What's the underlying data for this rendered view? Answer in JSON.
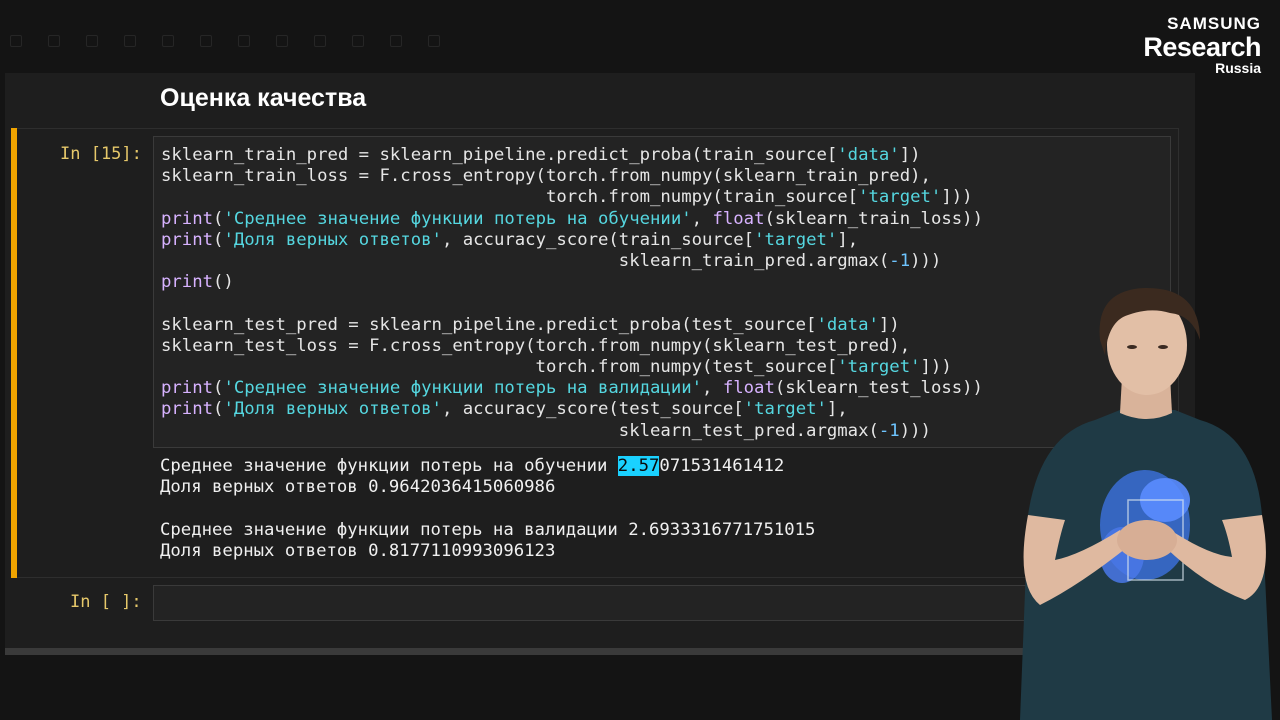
{
  "logo": {
    "line1": "SAMSUNG",
    "line2": "Research",
    "line3": "Russia"
  },
  "notebook": {
    "section_title": "Оценка качества",
    "cells": [
      {
        "prompt": "In [15]:",
        "code_lines": [
          "sklearn_train_pred = sklearn_pipeline.predict_proba(train_source['data'])",
          "sklearn_train_loss = F.cross_entropy(torch.from_numpy(sklearn_train_pred),",
          "                                     torch.from_numpy(train_source['target']))",
          "print('Среднее значение функции потерь на обучении', float(sklearn_train_loss))",
          "print('Доля верных ответов', accuracy_score(train_source['target'],",
          "                                            sklearn_train_pred.argmax(-1)))",
          "print()",
          "",
          "sklearn_test_pred = sklearn_pipeline.predict_proba(test_source['data'])",
          "sklearn_test_loss = F.cross_entropy(torch.from_numpy(sklearn_test_pred),",
          "                                    torch.from_numpy(test_source['target']))",
          "print('Среднее значение функции потерь на валидации', float(sklearn_test_loss))",
          "print('Доля верных ответов', accuracy_score(test_source['target'],",
          "                                            sklearn_test_pred.argmax(-1)))"
        ],
        "output": {
          "train_loss_label": "Среднее значение функции потерь на обучении ",
          "train_loss_highlight": "2.57",
          "train_loss_rest": "071531461412",
          "train_acc": "Доля верных ответов 0.9642036415060986",
          "test_loss": "Среднее значение функции потерь на валидации 2.6933316771751015",
          "test_acc": "Доля верных ответов 0.8177110993096123"
        }
      },
      {
        "prompt": "In [ ]:"
      }
    ]
  },
  "colors": {
    "cell_bar": "#f0a400",
    "selection": "#1ad1ff",
    "string": "#55d7e0",
    "keyword": "#d7b2ff"
  }
}
